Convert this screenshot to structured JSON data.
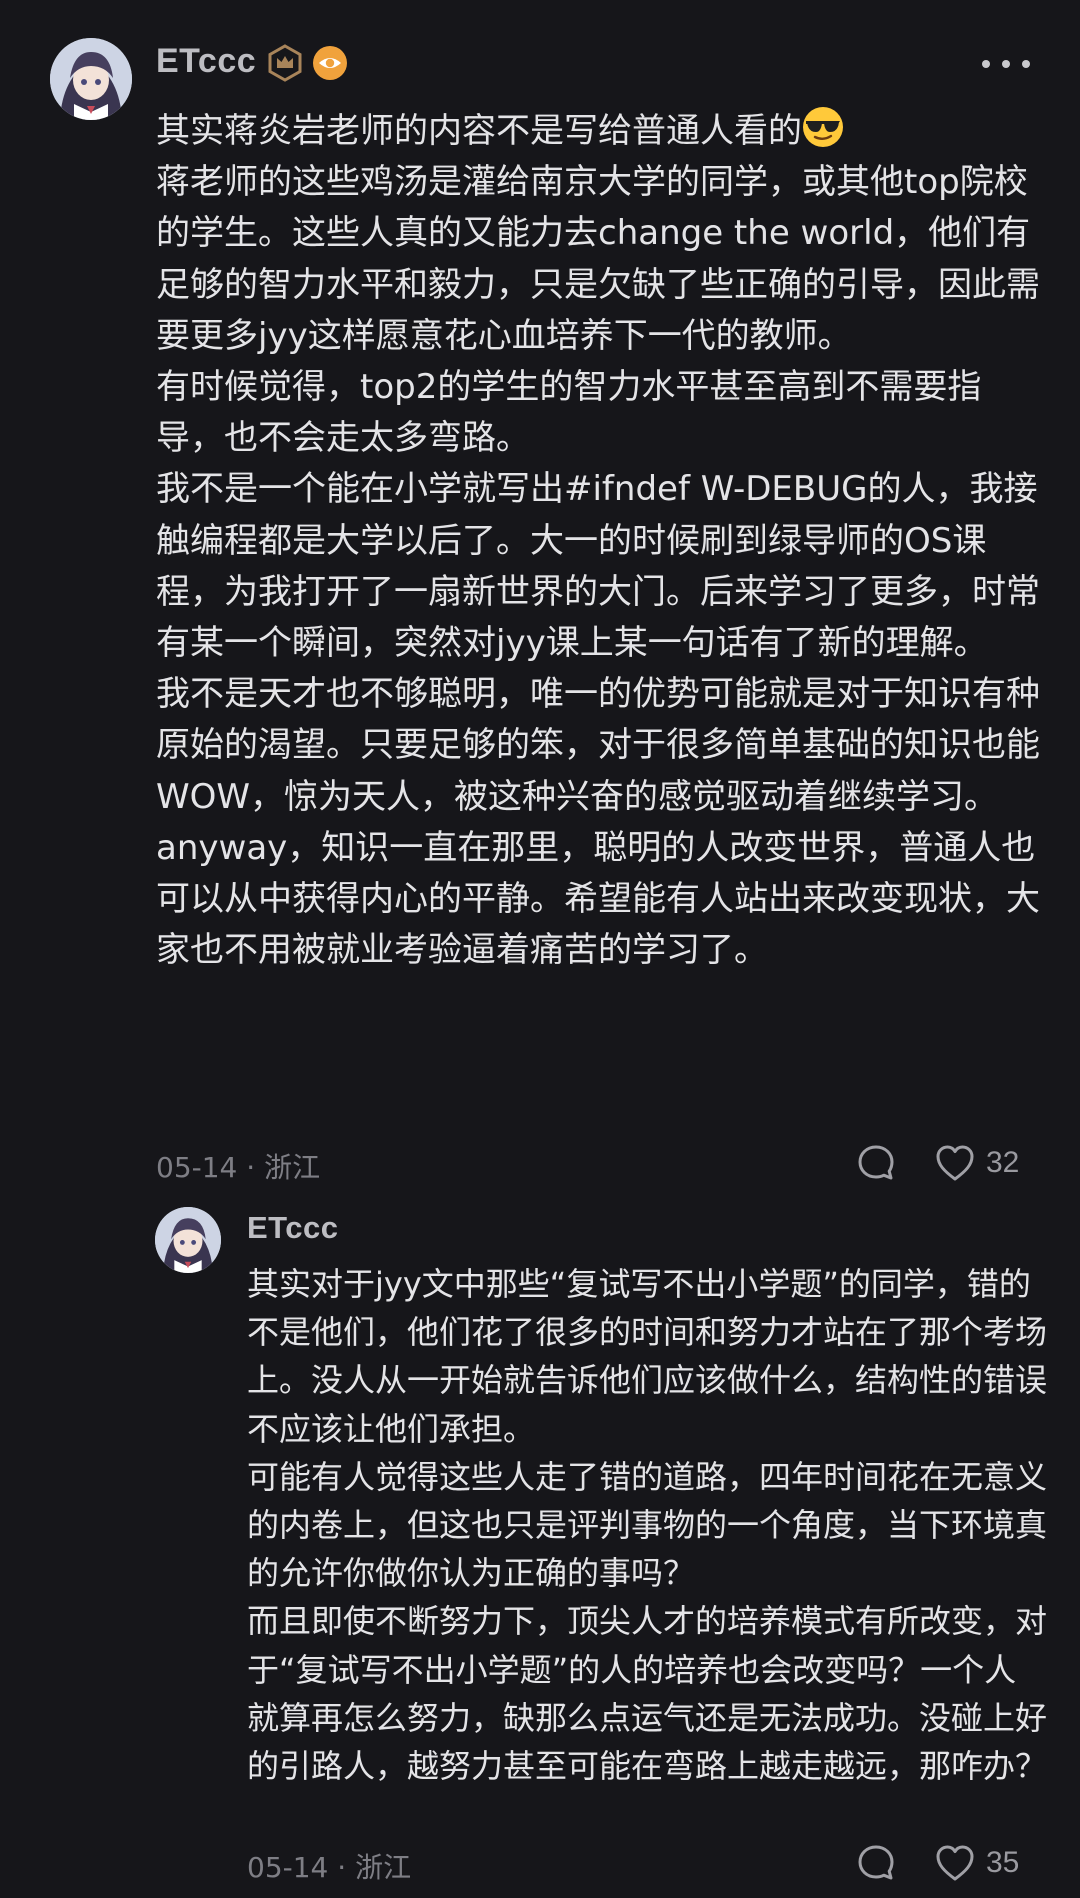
{
  "post": {
    "author": "ETccc",
    "paragraphs": [
      "其实蒋炎岩老师的内容不是写给普通人看的",
      "蒋老师的这些鸡汤是灌给南京大学的同学，或其他top院校的学生。这些人真的又能力去change the world，他们有足够的智力水平和毅力，只是欠缺了些正确的引导，因此需要更多jyy这样愿意花心血培养下一代的教师。",
      "有时候觉得，top2的学生的智力水平甚至高到不需要指导，也不会走太多弯路。",
      "我不是一个能在小学就写出#ifndef W-DEBUG的人，我接触编程都是大学以后了。大一的时候刷到绿导师的OS课程，为我打开了一扇新世界的大门。后来学习了更多，时常有某一个瞬间，突然对jyy课上某一句话有了新的理解。",
      "我不是天才也不够聪明，唯一的优势可能就是对于知识有种原始的渴望。只要足够的笨，对于很多简单基础的知识也能WOW，惊为天人，被这种兴奋的感觉驱动着继续学习。",
      "anyway，知识一直在那里，聪明的人改变世界，普通人也可以从中获得内心的平静。希望能有人站出来改变现状，大家也不用被就业考验逼着痛苦的学习了。"
    ],
    "meta": "05-14 · 浙江",
    "like_count": "32"
  },
  "reply": {
    "author": "ETccc",
    "paragraphs": [
      "其实对于jyy文中那些“复试写不出小学题”的同学，错的不是他们，他们花了很多的时间和努力才站在了那个考场上。没人从一开始就告诉他们应该做什么，结构性的错误不应该让他们承担。",
      "可能有人觉得这些人走了错的道路，四年时间花在无意义的内卷上，但这也只是评判事物的一个角度，当下环境真的允许你做你认为正确的事吗？",
      "而且即使不断努力下，顶尖人才的培养模式有所改变，对于“复试写不出小学题”的人的培养也会改变吗？一个人就算再怎么努力，缺那么点运气还是无法成功。没碰上好的引路人，越努力甚至可能在弯路上越走越远，那咋办？"
    ],
    "meta": "05-14 · 浙江",
    "like_count": "35"
  },
  "icons": {
    "level_badge": "crown-badge-icon",
    "vip_badge": "eye-badge-icon",
    "more": "more-dots-icon",
    "comment": "comment-bubble-icon",
    "like": "heart-icon",
    "emoji": "sunglasses-emoji-icon"
  },
  "colors": {
    "background": "#16161a",
    "text": "#e4e4e7",
    "muted": "#7e7e85",
    "badge_gold": "#a8845a",
    "badge_orange": "#f0a23c"
  }
}
